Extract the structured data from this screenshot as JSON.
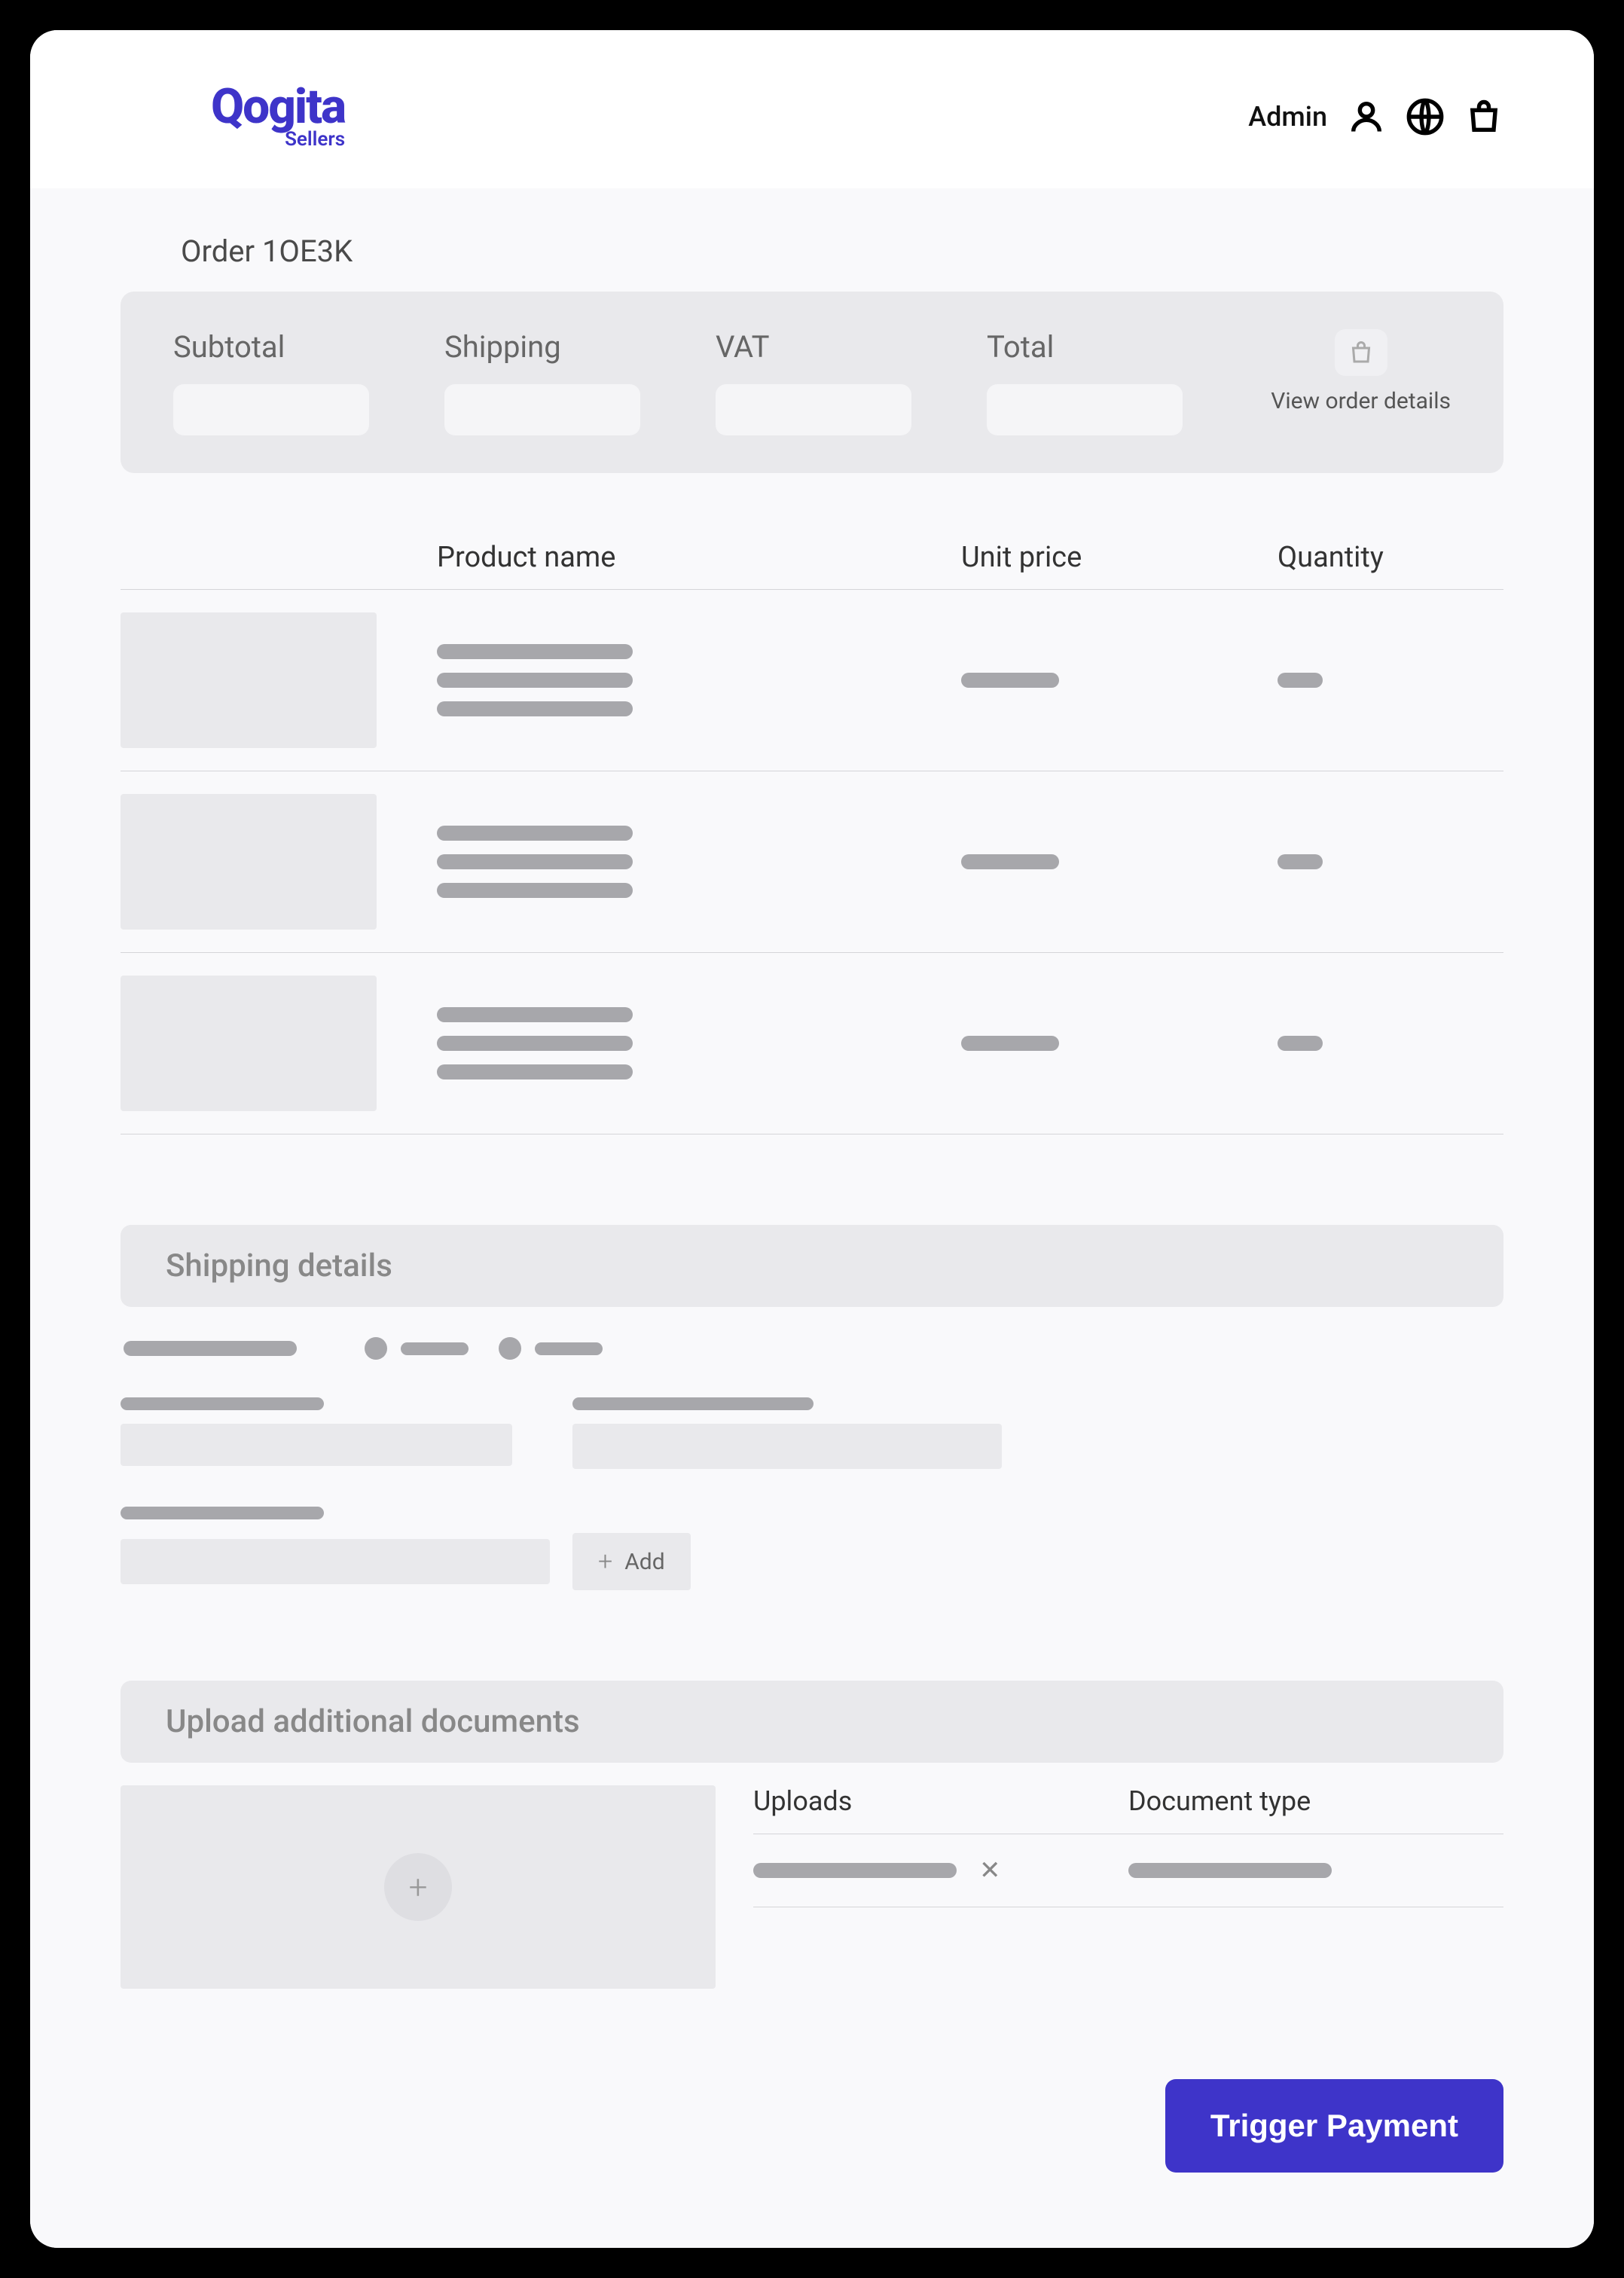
{
  "header": {
    "logo_main": "Qogita",
    "logo_sub": "Sellers",
    "admin_label": "Admin"
  },
  "order": {
    "title": "Order 1OE3K",
    "summary": {
      "subtotal_label": "Subtotal",
      "shipping_label": "Shipping",
      "vat_label": "VAT",
      "total_label": "Total",
      "view_details": "View order details"
    },
    "table": {
      "product_name": "Product name",
      "unit_price": "Unit price",
      "quantity": "Quantity"
    }
  },
  "shipping": {
    "heading": "Shipping details",
    "add_label": "Add"
  },
  "upload": {
    "heading": "Upload additional documents",
    "uploads_label": "Uploads",
    "doc_type_label": "Document type"
  },
  "actions": {
    "trigger_payment": "Trigger Payment"
  }
}
